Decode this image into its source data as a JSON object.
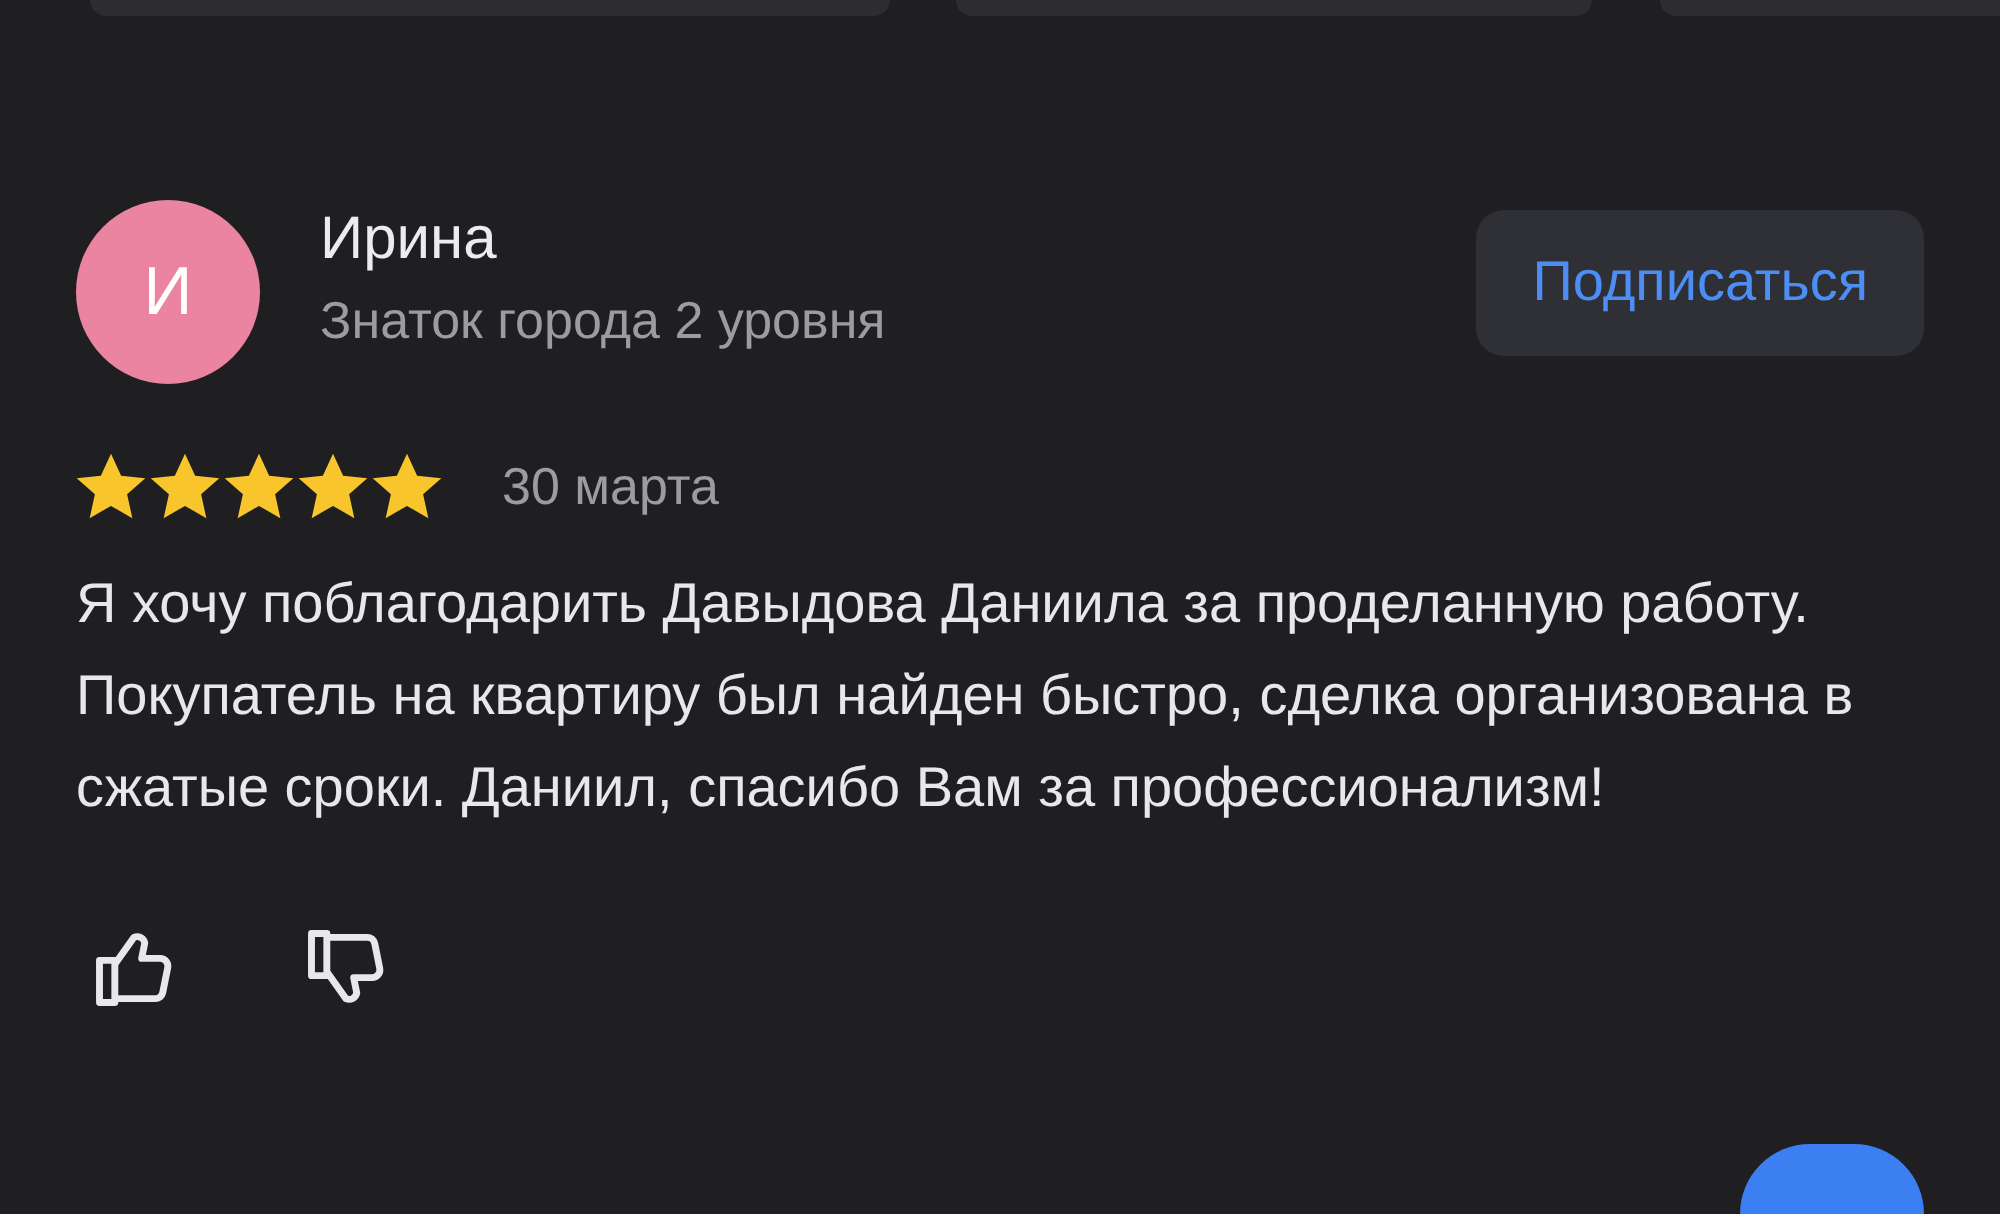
{
  "author": {
    "initial": "И",
    "name": "Ирина",
    "status": "Знаток города 2 уровня"
  },
  "subscribe_button": {
    "label": "Подписаться"
  },
  "rating": {
    "stars": 5
  },
  "date": "30 марта",
  "review_text": "Я хочу поблагодарить Давыдова Даниила за проделанную работу. Покупатель на квартиру был найден быстро, сделка организована в сжатые сроки. Даниил, спасибо Вам за профессионализм!",
  "reactions": {
    "liked": false,
    "disliked": false
  }
}
